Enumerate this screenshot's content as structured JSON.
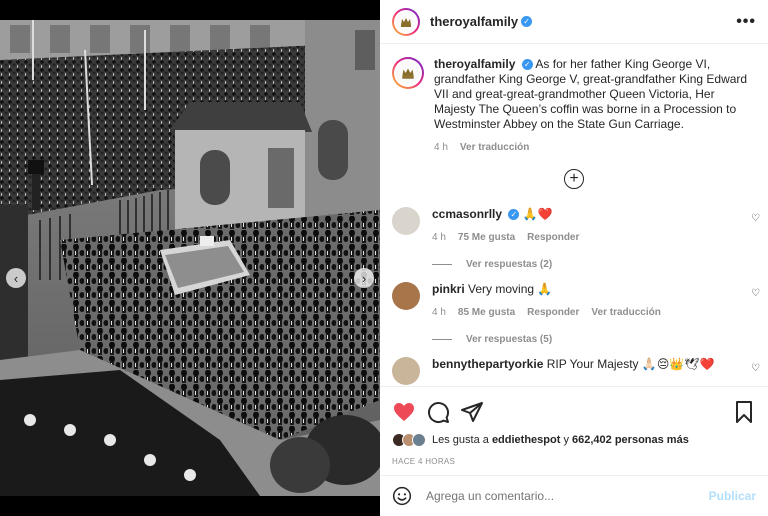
{
  "post": {
    "username": "theroyalfamily",
    "more_label": "•••"
  },
  "media": {
    "prev_glyph": "‹",
    "next_glyph": "›",
    "dot_count": 5,
    "active_dot": 2
  },
  "caption": {
    "username": "theroyalfamily",
    "text": "As for her father King George VI, grandfather King George V, great-grandfather King Edward VII and great-great-grandmother Queen Victoria, Her Majesty The Queen’s coffin was borne in a Procession to Westminster Abbey on the State Gun Carriage.",
    "time": "4 h",
    "translate": "Ver traducción"
  },
  "load_more_glyph": "+",
  "comments": [
    {
      "username": "ccmasonrlly",
      "verified": true,
      "text": "🙏❤️",
      "time": "4 h",
      "likes": "75 Me gusta",
      "reply": "Responder",
      "translate": "",
      "replies": "Ver respuestas (2)",
      "avatar_color": "#d9d4cc"
    },
    {
      "username": "pinkri",
      "verified": false,
      "text": "Very moving 🙏",
      "time": "4 h",
      "likes": "85 Me gusta",
      "reply": "Responder",
      "translate": "Ver traducción",
      "replies": "Ver respuestas (5)",
      "avatar_color": "#a8744a"
    },
    {
      "username": "bennythepartyorkie",
      "verified": false,
      "text": "RIP Your Majesty 🙏🏻😔👑🕊❤️",
      "avatar_color": "#c9b59a"
    }
  ],
  "likes": {
    "prefix": "Les gusta a",
    "user": "eddiethespot",
    "middle": "y",
    "count": "662,402 personas más"
  },
  "time_ago": "HACE 4 HORAS",
  "composer": {
    "placeholder": "Agrega un comentario...",
    "post_label": "Publicar"
  },
  "colors": {
    "heart": "#ed4956",
    "verified": "#3897f0",
    "muted": "#8e8e8e",
    "post_disabled": "#b2dffc"
  }
}
